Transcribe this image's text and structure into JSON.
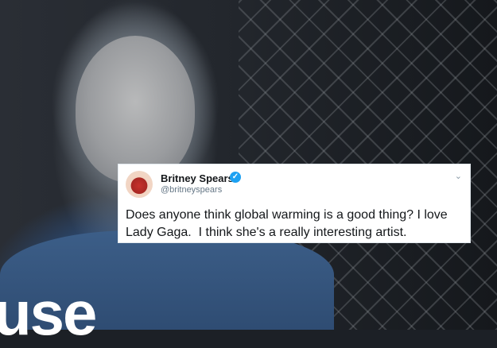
{
  "overlay_logo": {
    "text": "use"
  },
  "tweet": {
    "display_name": "Britney Spears",
    "handle": "@britneyspears",
    "verified_icon": "verified-check-icon",
    "menu_icon": "chevron-down-icon",
    "text": "Does anyone think global warming is a good thing? I love Lady Gaga.  I think she's a really interesting artist."
  },
  "colors": {
    "tweet_background": "#ffffff",
    "verified_badge": "#1da1f2",
    "handle_text": "#657786",
    "logo_text": "#ffffff"
  }
}
